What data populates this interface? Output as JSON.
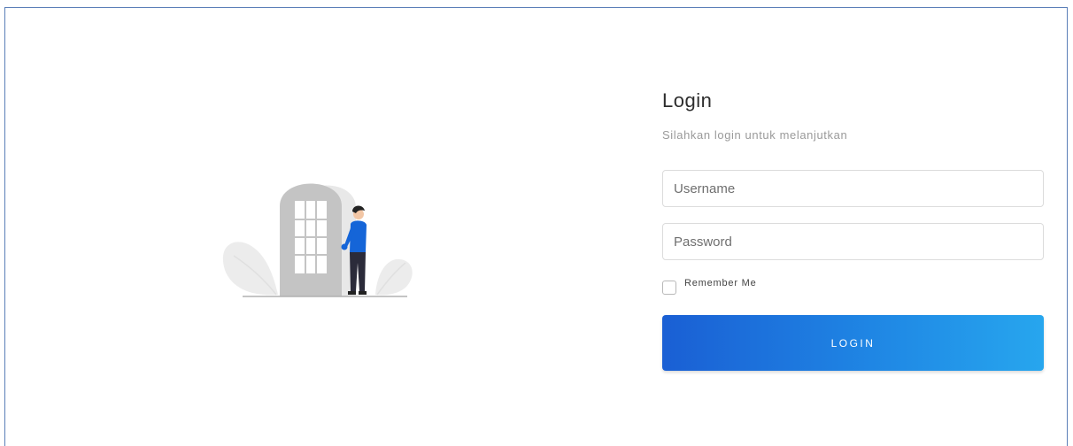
{
  "login": {
    "title": "Login",
    "subtitle": "Silahkan login untuk melanjutkan",
    "username_placeholder": "Username",
    "username_value": "",
    "password_placeholder": "Password",
    "password_value": "",
    "remember_label": "Remember Me",
    "remember_checked": false,
    "button_label": "LOGIN"
  },
  "colors": {
    "accent": "#1f86e4",
    "accent_dark": "#1a5fd4",
    "accent_light": "#27a6ee",
    "frame_border": "#5b7fb8",
    "person_shirt": "#1565d8"
  },
  "icons": {
    "illustration": "person-at-door-illustration"
  }
}
